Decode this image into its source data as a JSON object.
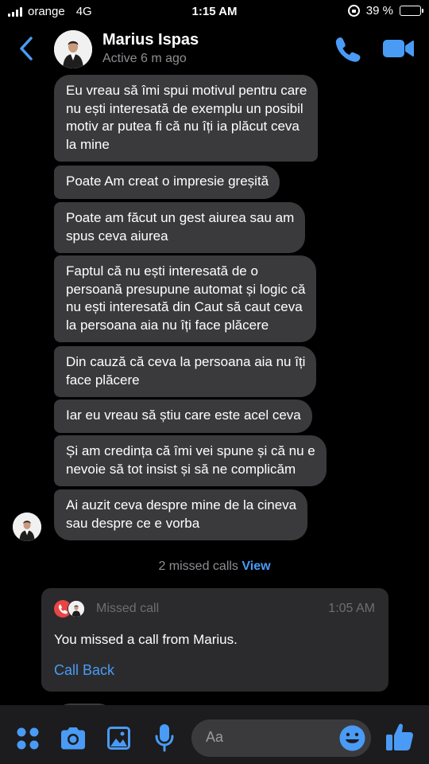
{
  "status_bar": {
    "carrier": "orange",
    "network": "4G",
    "time": "1:15 AM",
    "battery": "39 %",
    "battery_level": 0.39
  },
  "header": {
    "contact_name": "Marius Ispas",
    "contact_status": "Active 6 m ago",
    "icons": [
      "back-icon",
      "call-icon",
      "video-call-icon"
    ]
  },
  "messages": [
    {
      "lines": [
        "Eu vreau să îmi spui motivul pentru care",
        "nu ești interesată de exemplu un posibil",
        "motiv ar putea fi că nu îți ia plăcut ceva",
        "la mine"
      ]
    },
    {
      "lines": [
        "Poate Am creat o impresie greșită"
      ]
    },
    {
      "lines": [
        "Poate am făcut un gest aiurea sau am",
        "spus ceva aiurea"
      ]
    },
    {
      "lines": [
        "Faptul că nu ești interesată de o",
        "persoană presupune automat și logic că",
        "nu ești interesată din Caut să caut ceva",
        "la persoana aia nu îți face plăcere"
      ]
    },
    {
      "lines": [
        "Din cauză că ceva la persoana aia nu îți",
        "face plăcere"
      ]
    },
    {
      "lines": [
        "Iar eu vreau să știu care este acel ceva"
      ]
    },
    {
      "lines": [
        "Și am credința că îmi vei spune și că nu e",
        "nevoie să tot insist și să ne complicăm"
      ]
    },
    {
      "lines": [
        "Ai auzit ceva despre mine de la cineva",
        "sau despre ce e vorba"
      ]
    }
  ],
  "missed_summary": {
    "text": "2 missed calls ",
    "link": "View"
  },
  "call_card": {
    "title": "Missed call",
    "time": "1:05 AM",
    "text": "You missed a call from Marius.",
    "action": "Call Back"
  },
  "composer": {
    "placeholder": "Aa",
    "icons": [
      "apps-icon",
      "camera-icon",
      "gallery-icon",
      "microphone-icon",
      "emoji-icon",
      "like-icon"
    ]
  },
  "colors": {
    "accent": "#4a9bf5",
    "bubble": "#3a3a3c",
    "background": "#000000",
    "missed_call_red": "#e94545"
  }
}
